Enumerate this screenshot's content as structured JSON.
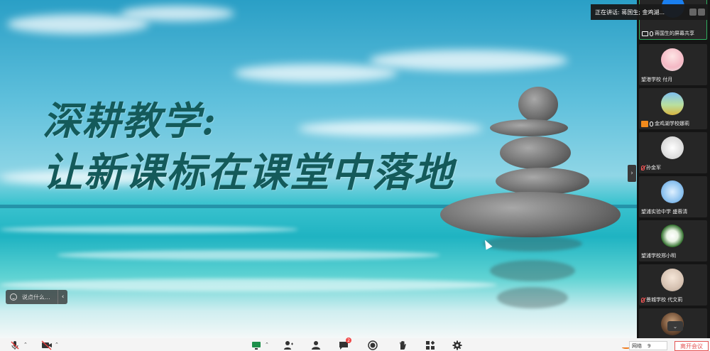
{
  "slide": {
    "title_line1": "深耕教学:",
    "title_line2": "让新课标在课堂中落地"
  },
  "chat": {
    "placeholder": "说点什么..."
  },
  "speaker_banner": {
    "text": "正在讲话: 蒋国生; 金鸡湖..."
  },
  "participants": [
    {
      "name": "蒋国生的屏幕共享",
      "status": "screen-share",
      "avatar": "blue-screen"
    },
    {
      "name": "望港学校 付月",
      "status": "none",
      "avatar": "girl-pink"
    },
    {
      "name": "金鸡湖学校娜莉",
      "status": "camera-mic",
      "avatar": "field"
    },
    {
      "name": "孙金军",
      "status": "mic-off",
      "avatar": "sketch"
    },
    {
      "name": "望浦实验中学 盛蓉清",
      "status": "none",
      "avatar": "cartoon"
    },
    {
      "name": "望浦学校郑小明",
      "status": "none",
      "avatar": "flower"
    },
    {
      "name": "景城学校 代文莉",
      "status": "mic-off",
      "avatar": "portrait"
    },
    {
      "name": "",
      "status": "none",
      "avatar": "dark"
    }
  ],
  "toolbar": {
    "chat_badge": "2",
    "network_label": "网络",
    "network_value": "9",
    "leave_label": "离开会议"
  },
  "colors": {
    "active_tile_border": "#2fae5f",
    "leave_red": "#e45454",
    "title_teal": "#145a5a"
  }
}
